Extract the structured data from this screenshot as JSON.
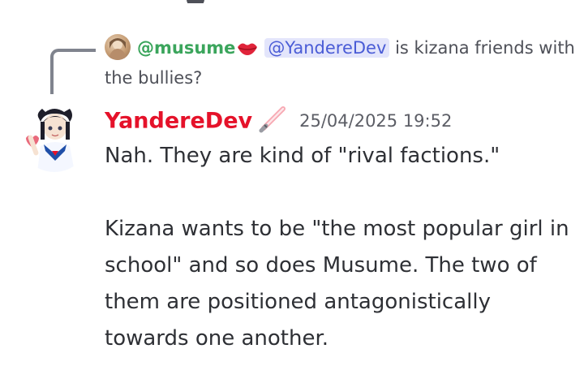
{
  "reply": {
    "username": "@musume",
    "mention": "@YandereDev",
    "text": "is kizana friends with the bullies?",
    "emoji_icon": "kiss-lips-icon"
  },
  "message": {
    "author": "YandereDev",
    "role_icon": "lightsaber-icon",
    "timestamp": "25/04/2025 19:52",
    "paragraphs": [
      "Nah. They are kind of \"rival factions.\"",
      "Kizana wants to be \"the most popular girl in school\" and so does Musume. The two of them are positioned antagonistically towards one another."
    ]
  },
  "colors": {
    "author": "#e5122a",
    "reply_name": "#3ba55c",
    "mention": "#4a5cd6",
    "mention_bg": "#e3e5fb"
  }
}
